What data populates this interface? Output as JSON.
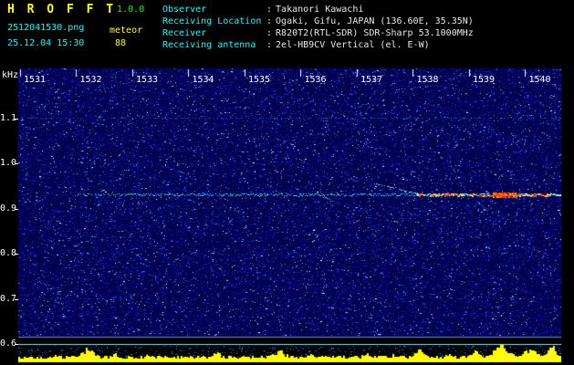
{
  "header": {
    "title": "H R O F F T",
    "version": "1.0.0",
    "filename": "2512041530.png",
    "mode": "meteor",
    "datetime": "25.12.04 15:30",
    "count": "88",
    "separator": ":",
    "info": [
      {
        "label": "Observer",
        "value": "Takanori Kawachi"
      },
      {
        "label": "Receiving Location",
        "value": "Ogaki, Gifu, JAPAN (136.60E, 35.35N)"
      },
      {
        "label": "Receiver",
        "value": "R820T2(RTL-SDR) SDR-Sharp 53.1000MHz"
      },
      {
        "label": "Receiving antenna",
        "value": "2el-HB9CV Vertical (el. E-W)"
      }
    ]
  },
  "spectrogram": {
    "ylabel": "kHz",
    "freq_ticks": [
      "1.1",
      "1.0",
      "0.9",
      "0.8",
      "0.7",
      "0.6"
    ],
    "time_ticks": [
      "1531",
      "1532",
      "1533",
      "1534",
      "1535",
      "1536",
      "1537",
      "1538",
      "1539",
      "1540"
    ],
    "freq_range_khz": [
      0.6,
      1.1
    ],
    "trace": {
      "frequency_khz": 0.93,
      "from": "1531",
      "to": "1540",
      "strongest": "1538-1540"
    }
  },
  "chart_data": {
    "type": "heatmap",
    "subtype": "radio-meteor-spectrogram",
    "x_tick_labels": [
      "1531",
      "1532",
      "1533",
      "1534",
      "1535",
      "1536",
      "1537",
      "1538",
      "1539",
      "1540"
    ],
    "ylabel": "kHz",
    "ylim": [
      0.6,
      1.15
    ],
    "y_tick_labels": [
      "1.1",
      "1.0",
      "0.9",
      "0.8",
      "0.7",
      "0.6"
    ],
    "signals": [
      {
        "kind": "continuous-carrier-trace",
        "frequency_khz": 0.93,
        "time_span": [
          "1531",
          "1540"
        ],
        "intensity": "weak cyan/green 1531-1537, strong with orange-red peak 1538-1540"
      },
      {
        "kind": "drifting-echo",
        "from_khz": 0.95,
        "to_khz": 0.93,
        "time": "1537-1538"
      }
    ],
    "bottom_level_bars": {
      "color": "#ffff00",
      "description": "wideband level bars, bursts near 1532, 1536, 1538-1540 (tall at right edge)"
    }
  },
  "colors": {
    "title": "#ffff00",
    "version": "#00ff00",
    "cyan": "#00ffff",
    "value_text": "#e8e8e8",
    "axis_text": "#ffffff",
    "noise_base": "#00004e",
    "bars": "#ffff00"
  }
}
